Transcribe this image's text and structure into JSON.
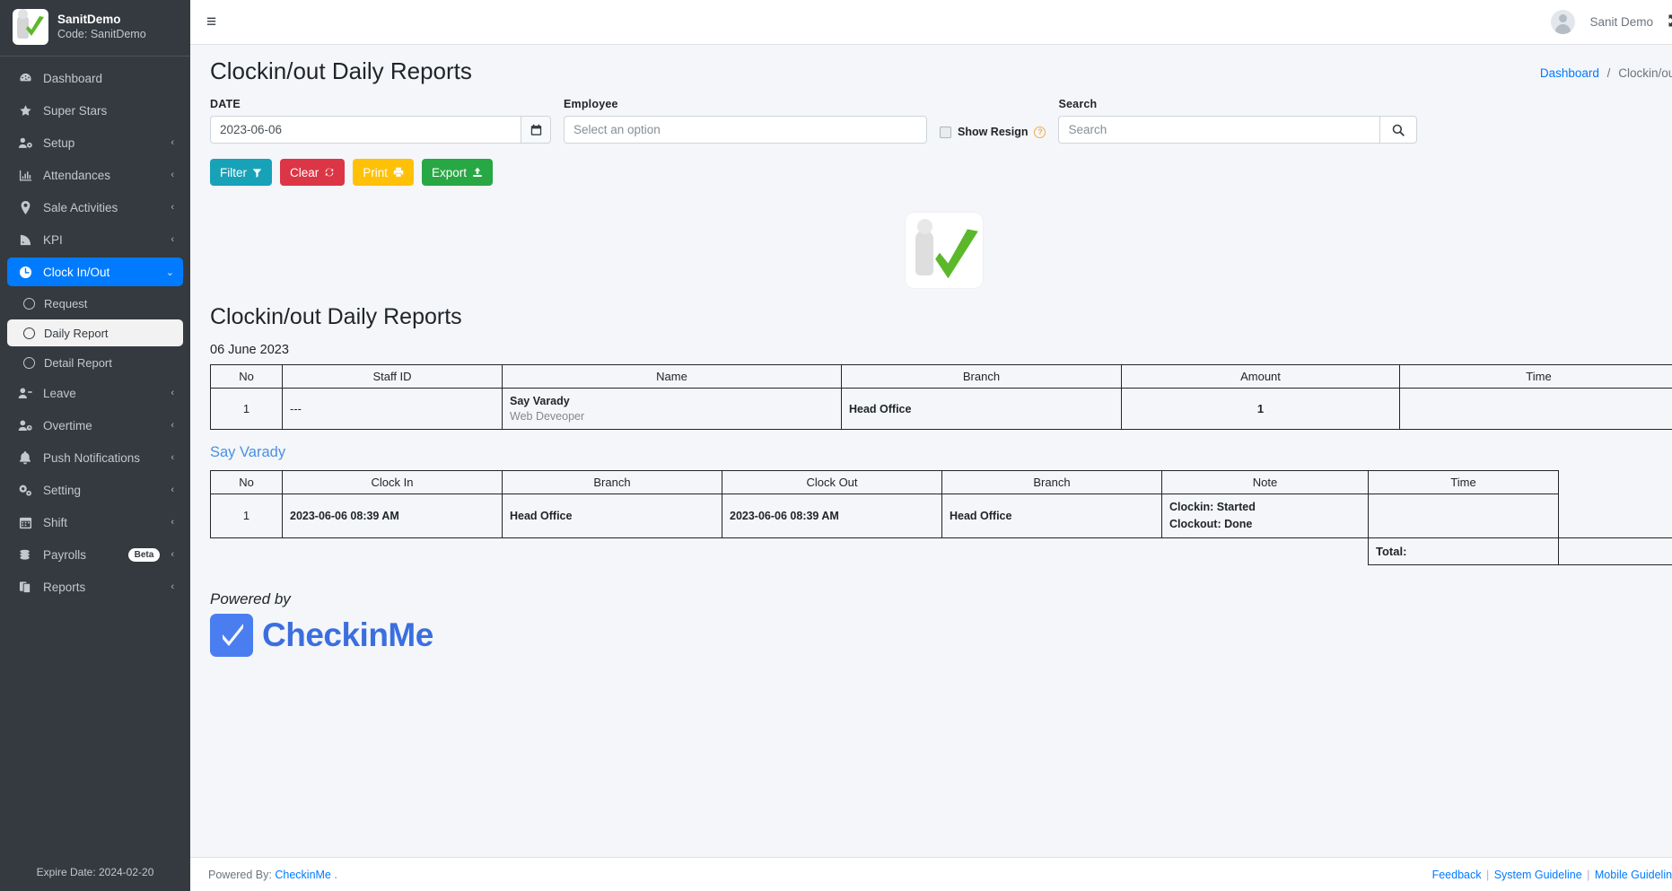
{
  "sidebar": {
    "brand": {
      "title": "SanitDemo",
      "code": "Code: SanitDemo"
    },
    "items": [
      {
        "label": "Dashboard",
        "icon": "dashboard-icon",
        "arrow": ""
      },
      {
        "label": "Super Stars",
        "icon": "star-icon",
        "arrow": ""
      },
      {
        "label": "Setup",
        "icon": "user-gear-icon",
        "arrow": "‹"
      },
      {
        "label": "Attendances",
        "icon": "chart-bar-icon",
        "arrow": "‹"
      },
      {
        "label": "Sale Activities",
        "icon": "map-pin-icon",
        "arrow": "‹"
      },
      {
        "label": "KPI",
        "icon": "signal-icon",
        "arrow": "‹"
      },
      {
        "label": "Clock In/Out",
        "icon": "clock-icon",
        "arrow": "⌄"
      },
      {
        "label": "Leave",
        "icon": "user-minus-icon",
        "arrow": "‹"
      },
      {
        "label": "Overtime",
        "icon": "user-clock-icon",
        "arrow": "‹"
      },
      {
        "label": "Push Notifications",
        "icon": "bell-icon",
        "arrow": "‹"
      },
      {
        "label": "Setting",
        "icon": "gears-icon",
        "arrow": "‹"
      },
      {
        "label": "Shift",
        "icon": "calendar-icon",
        "arrow": "‹"
      },
      {
        "label": "Payrolls",
        "icon": "coins-icon",
        "arrow": "‹",
        "badge": "Beta"
      },
      {
        "label": "Reports",
        "icon": "copy-icon",
        "arrow": "‹"
      }
    ],
    "submenu": [
      {
        "label": "Request"
      },
      {
        "label": "Daily Report"
      },
      {
        "label": "Detail Report"
      }
    ],
    "expire": "Expire Date: 2024-02-20"
  },
  "topbar": {
    "hamburger": "≡",
    "user_name": "Sanit Demo",
    "expand_icon": "⤢"
  },
  "page": {
    "title": "Clockin/out Daily Reports",
    "breadcrumb": {
      "home": "Dashboard",
      "separator": "/",
      "current": "Clockin/out"
    }
  },
  "filters": {
    "date_label": "DATE",
    "date_value": "2023-06-06",
    "calendar_icon": "🗓",
    "employee_label": "Employee",
    "employee_placeholder": "Select an option",
    "show_resign_label": "Show Resign",
    "show_resign_help": "?",
    "search_label": "Search",
    "search_placeholder": "Search",
    "search_icon": "🔍"
  },
  "buttons": {
    "filter": "Filter",
    "filter_icon": "▼",
    "clear": "Clear",
    "clear_icon": "↻",
    "print": "Print",
    "print_icon": "⎙",
    "export": "Export",
    "export_icon": "⇧"
  },
  "report": {
    "title": "Clockin/out Daily Reports",
    "date": "06 June 2023",
    "summary_table": {
      "headers": [
        "No",
        "Staff ID",
        "Name",
        "Branch",
        "Amount",
        "Time"
      ],
      "rows": [
        {
          "no": "1",
          "staff_id": "---",
          "name": "Say Varady",
          "position": "Web Deveoper",
          "branch": "Head Office",
          "amount": "1",
          "time": ""
        }
      ]
    },
    "employee_link": "Say Varady",
    "detail_table": {
      "headers": [
        "No",
        "Clock In",
        "Branch",
        "Clock Out",
        "Branch",
        "Note",
        "Time",
        ""
      ],
      "rows": [
        {
          "no": "1",
          "clock_in": "2023-06-06 08:39 AM",
          "branch_in": "Head Office",
          "clock_out": "2023-06-06 08:39 AM",
          "branch_out": "Head Office",
          "note_in": "Clockin:  Started",
          "note_out": "Clockout: Done",
          "time": ""
        }
      ],
      "total_label": "Total:",
      "total_value": ""
    },
    "powered_by": "Powered by",
    "brand_word": "CheckinMe"
  },
  "footer": {
    "powered_prefix": "Powered By:",
    "powered_link": "CheckinMe",
    "powered_suffix": ".",
    "feedback": "Feedback",
    "sep1": "|",
    "system_guideline": "System Guideline",
    "sep2": "|",
    "mobile_guideline": "Mobile Guideline"
  },
  "colors": {
    "sidebar_bg": "#343a40",
    "active_blue": "#007bff",
    "filter_teal": "#17a2b8",
    "clear_red": "#dc3545",
    "print_yellow": "#ffc107",
    "export_green": "#28a745",
    "link_blue": "#4a90e2"
  }
}
